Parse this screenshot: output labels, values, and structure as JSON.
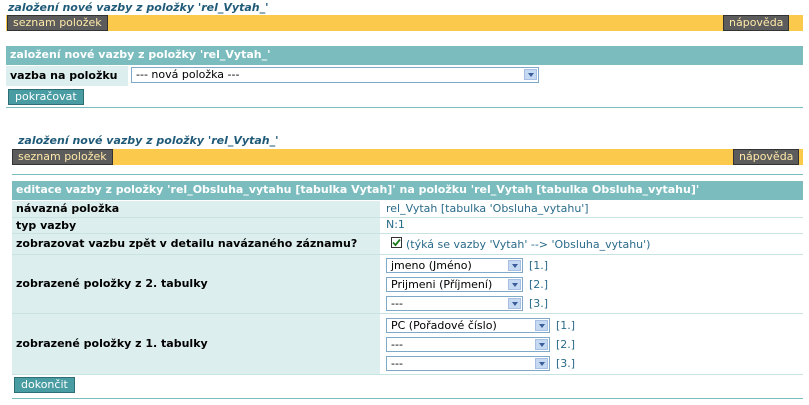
{
  "top": {
    "title": "založení nové vazby z položky 'rel_Vytah_'",
    "list_button": "seznam položek",
    "help_button": "nápověda"
  },
  "form1": {
    "header": "založení nové vazby z položky 'rel_Vytah_'",
    "field_label": "vazba na položku",
    "select_value": "--- nová položka ---",
    "submit": "pokračovat"
  },
  "section2": {
    "title": "založení nové vazby z položky 'rel_Vytah_'",
    "list_button": "seznam položek",
    "help_button": "nápověda",
    "header": "editace vazby z položky 'rel_Obsluha_vytahu [tabulka Vytah]' na položku 'rel_Vytah [tabulka Obsluha_vytahu]'",
    "linked_item_label": "návazná položka",
    "linked_item_value": "rel_Vytah [tabulka 'Obsluha_vytahu']",
    "link_type_label": "typ vazby",
    "link_type_value": "N:1",
    "show_back_label": "zobrazovat vazbu zpět v detailu navázaného záznamu?",
    "show_back_checked": true,
    "show_back_note": "(týká se vazby 'Vytah' --> 'Obsluha_vytahu')",
    "table2_label": "zobrazené položky z 2. tabulky",
    "table2_selects": [
      {
        "value": "jmeno (Jméno)",
        "index": "[1.]"
      },
      {
        "value": "Prijmeni (Příjmení)",
        "index": "[2.]"
      },
      {
        "value": "---",
        "index": "[3.]"
      }
    ],
    "table1_label": "zobrazené položky z 1. tabulky",
    "table1_selects": [
      {
        "value": "PC (Pořadové číslo)",
        "index": "[1.]"
      },
      {
        "value": "---",
        "index": "[2.]"
      },
      {
        "value": "---",
        "index": "[3.]"
      }
    ],
    "finish": "dokončit"
  }
}
